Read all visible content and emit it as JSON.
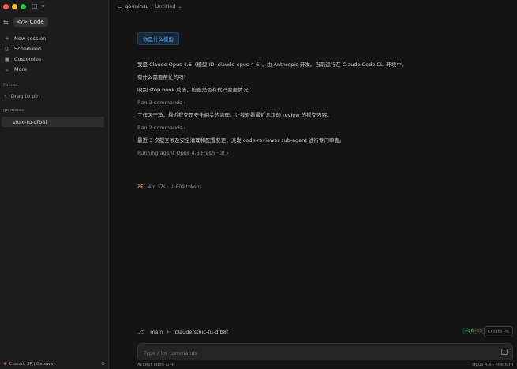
{
  "sidebar": {
    "code_label": "Code",
    "nav": [
      {
        "icon": "plus-icon",
        "label": "New session"
      },
      {
        "icon": "clock-icon",
        "label": "Scheduled"
      },
      {
        "icon": "briefcase-icon",
        "label": "Customize"
      },
      {
        "icon": "chevron-down-icon",
        "label": "More"
      }
    ],
    "pinned_heading": "Pinned",
    "drag_to_pin": "Drag to pin",
    "group_heading": "go-minsu",
    "active_session": "stoic-tu-dfb8f",
    "footer_label": "Cowork 3P | Gateway"
  },
  "header": {
    "project": "go-minsu",
    "separator": "/",
    "title": "Untitled"
  },
  "conversation": {
    "user_message": "你是什么模型",
    "lines": [
      {
        "text": "我是 Claude Opus 4.6（模型 ID: claude-opus-4-6），由 Anthropic 开发。当前运行在 Claude Code CLI 环境中。",
        "kind": "text"
      },
      {
        "text": "有什么需要帮忙的吗?",
        "kind": "text"
      },
      {
        "text": "收到 stop hook 反馈，检查是否有代码变更情况。",
        "kind": "text"
      },
      {
        "text": "Ran 3 commands ›",
        "kind": "sub"
      },
      {
        "text": "工作区干净，最近提交是安全相关的清理。让我查看最近几次的 review 的提交内容。",
        "kind": "text"
      },
      {
        "text": "Ran 2 commands ›",
        "kind": "sub"
      },
      {
        "text": "最近 3 次提交涉及安全清理和配置变更，派发 code-reviewer sub-agent 进行专门审查。",
        "kind": "text"
      },
      {
        "text": "Running agent Opus 4.6 Fresh · 3! ›",
        "kind": "sub"
      }
    ],
    "status_text": "4m 37s · ↓ 609 tokens"
  },
  "footer": {
    "branch": "main",
    "arrow": "←",
    "target_branch": "claude/stoic-tu-dfb8f",
    "additions": "+26",
    "deletions": "-13",
    "create_pr_label": "Create PR",
    "composer_placeholder": "Type / for commands",
    "accept_edits_label": "Accept edits",
    "model_label": "Opus 4.6 · Medium"
  },
  "colors": {
    "accent": "#d97757",
    "user_bubble_text": "#5aa8e6",
    "addition": "#4fc36b",
    "deletion": "#e05555"
  }
}
